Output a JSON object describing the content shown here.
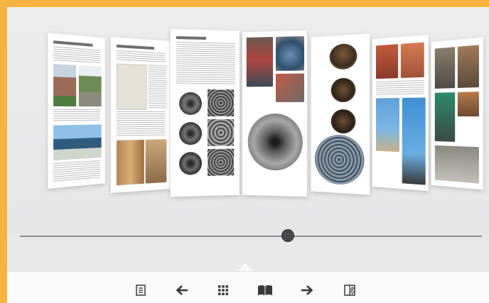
{
  "viewer": {
    "accent_color": "#f6b33f",
    "background_color": "#e9e9ea",
    "slider": {
      "position": 0.58
    },
    "pages": [
      {
        "index": 1,
        "theme": "gates-and-architecture"
      },
      {
        "index": 2,
        "theme": "hand-drawn-map"
      },
      {
        "index": 3,
        "theme": "spiral-metal-bowls"
      },
      {
        "index": 4,
        "theme": "metal-vessels"
      },
      {
        "index": 5,
        "theme": "bronze-bowls"
      },
      {
        "index": 6,
        "theme": "sculptures-outdoors"
      },
      {
        "index": 7,
        "theme": "studio-workshop"
      }
    ]
  },
  "toolbar": {
    "buttons": [
      {
        "name": "table-of-contents-button",
        "icon": "list-icon"
      },
      {
        "name": "previous-page-button",
        "icon": "arrow-left-icon"
      },
      {
        "name": "thumbnails-button",
        "icon": "grid-icon"
      },
      {
        "name": "book-view-button",
        "icon": "open-book-icon"
      },
      {
        "name": "next-page-button",
        "icon": "arrow-right-icon"
      },
      {
        "name": "single-page-view-button",
        "icon": "page-layout-icon"
      }
    ]
  }
}
